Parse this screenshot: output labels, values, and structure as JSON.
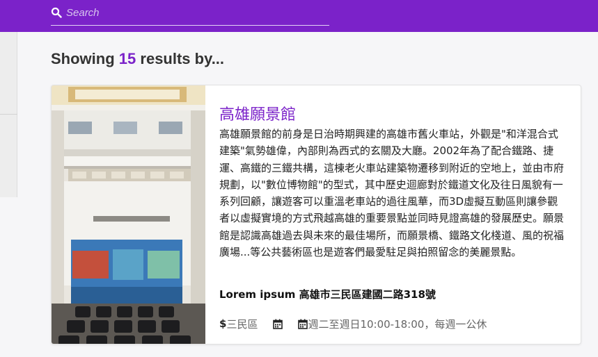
{
  "search": {
    "placeholder": "Search"
  },
  "results": {
    "prefix": "Showing",
    "count": "15",
    "suffix": "results by..."
  },
  "card": {
    "title": "高雄願景館",
    "description": "高雄願景館的前身是日治時期興建的高雄市舊火車站，外觀是\"和洋混合式建築\"氣勢雄偉，內部則為西式的玄關及大廳。2002年為了配合鐵路、捷運、高鐵的三鐵共構，這棟老火車站建築物遷移到附近的空地上，並由市府規劃，以\"數位博物館\"的型式，其中歷史迴廊對於鐵道文化及往日風貌有一系列回顧，讓遊客可以重溫老車站的過往風華，而3D虛擬互動區則讓參觀者以虛擬實境的方式飛越高雄的重要景點並同時見證高雄的發展歷史。願景館是認識高雄過去與未來的最佳場所，而願景橋、鐵路文化棧道、風的祝福廣場...等公共藝術區也是遊客們最愛駐足與拍照留念的美麗景點。",
    "address": "Lorem ipsum 高雄市三民區建國二路318號",
    "district": "三民區",
    "hours": "週二至週日10:00-18:00，每週一公休",
    "icons": [
      "dollar-icon",
      "calendar-icon",
      "calendar-icon"
    ]
  },
  "colors": {
    "accent": "#7b22c9",
    "background": "#f6f6f8"
  }
}
